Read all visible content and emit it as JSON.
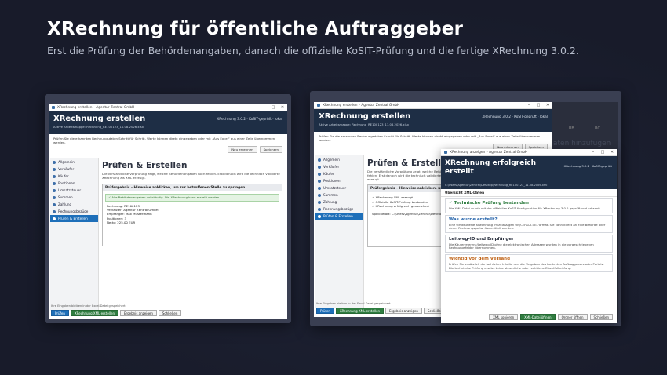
{
  "page": {
    "title": "XRechnung für öffentliche Auftraggeber",
    "subtitle": "Erst die Prüfung der Behördenangaben, danach die offizielle KoSIT-Prüfung und die fertige XRechnung 3.0.2."
  },
  "left": {
    "titlebar": "XRechnung erstellen – Agentur Zentral GmbH",
    "header_title": "XRechnung erstellen",
    "header_version": "XRechnung 3.0.2 · KoSIT-geprüft · lokal",
    "header_sub": "Aktive Arbeitsmappe: Rechnung_RE100123_11.08.2026.xlsx",
    "intro": "Prüfen Sie die erkannten Rechnungsdaten Schritt für Schritt. Werte können direkt eingegeben oder mit „Aus Excel“ aus einer Zeile übernommen werden.",
    "btn_new": "Neu erkennen",
    "btn_save": "Speichern",
    "nav": [
      "Allgemein",
      "Verkäufer",
      "Käufer",
      "Positionen",
      "Umsatzsteuer",
      "Summen",
      "Zahlung",
      "Rechnungsbezüge",
      "Prüfen & Erstellen"
    ],
    "main_title": "Prüfen & Erstellen",
    "main_desc": "Die verständliche Vorprüfung zeigt, welche Behördenangaben noch fehlen. Erst danach wird die technisch validierte XRechnung als XML erzeugt.",
    "box_header": "Prüfergebnis – Hinweise anklicken, um zur betroffenen Stelle zu springen",
    "ok_text": "✓ Alle Behördenangaben vollständig. Die XRechnung kann erstellt werden.",
    "lines": [
      "Rechnung: RE100123",
      "Verkäufer: Agentur Zentral GmbH",
      "Empfänger: Max Mustermann",
      "Positionen: 3",
      "Netto: 225,00 EUR"
    ],
    "status": "Ihre Eingaben bleiben in der Excel-Datei gespeichert.",
    "actions": [
      "Prüfen",
      "XRechnung XML erstellen",
      "Ergebnis anzeigen",
      "Schließen"
    ]
  },
  "right": {
    "titlebar": "XRechnung erstellen – Agentur Zentral GmbH",
    "header_title": "XRechnung erstellen",
    "header_version": "XRechnung 3.0.2 · KoSIT-geprüft · lokal",
    "header_sub": "Aktive Arbeitsmappe: Rechnung_RE100123_11.08.2026.xlsx",
    "intro": "Prüfen Sie die erkannten Rechnungsdaten Schritt für Schritt. Werte können direkt eingegeben oder mit „Aus Excel“ aus einer Zeile übernommen werden.",
    "btn_new": "Neu erkennen",
    "btn_save": "Speichern",
    "nav": [
      "Allgemein",
      "Verkäufer",
      "Käufer",
      "Positionen",
      "Umsatzsteuer",
      "Summen",
      "Zahlung",
      "Rechnungsbezüge",
      "Prüfen & Erstellen"
    ],
    "main_title": "Prüfen & Erstellen",
    "main_desc": "Die verständliche Vorprüfung zeigt, welche Behördenangaben noch fehlen. Erst danach wird die technisch validierte XRechnung als XML erzeugt.",
    "box_header": "Prüfergebnis – Hinweise anklicken, um zur betroffenen Stelle zu springen",
    "lines": [
      "✓ XRechnung-XML erzeugt",
      "✓ Offizielle KoSIT-Prüfung bestanden",
      "✓ XRechnung erfolgreich gespeichert"
    ],
    "saved": "Speicherort: C:\\Users\\Agentur\\Zentral\\Desktop\\",
    "status": "Ihre Eingaben bleiben in der Excel-Datei gespeichert.",
    "actions": [
      "Prüfen",
      "XRechnung XML erstellen",
      "Ergebnis anzeigen",
      "Schließen"
    ],
    "bg_text": "aten hinzufügen",
    "bg_cols": [
      "BB",
      "BC"
    ]
  },
  "dialog": {
    "titlebar": "XRechnung anzeigen – Agentur Zentral GmbH",
    "title": "XRechnung erfolgreich erstellt",
    "version": "XRechnung 3.0.2 · KoSIT-geprüft",
    "path": "C:\\Users\\Agentur\\Zentral\\Desktop\\Rechnung_RE100123_11.08.2026.xml",
    "tabs": "Übersicht  XML-Daten",
    "sections": [
      {
        "title": "✓ Technische Prüfung bestanden",
        "color": "#2f7d40",
        "text": "Die XML-Datei wurde mit der offiziellen KoSIT-Konfiguration für XRechnung 3.0.2 geprüft und erkannt."
      },
      {
        "title": "Was wurde erstellt?",
        "color": "#1e5fa8",
        "text": "Eine strukturierte XRechnung im zulässigen UN/CEFACT-CII-Format. Sie kann direkt an eine Behörde oder deren Rechnungsportal übermittelt werden."
      },
      {
        "title": "Leitweg-ID und Empfänger",
        "color": "#2c3240",
        "text": "Die Käuferreferenz/Leitweg-ID ohne die elektronischen Adressen wurden in die vorgeschriebenen Rechnungsfelder übernommen."
      },
      {
        "title": "Wichtig vor dem Versand",
        "color": "#c0651a",
        "text": "Prüfen Sie zusätzlich die fachlichen Inhalte und die Vorgaben des konkreten Auftraggebers oder Portals. Die technische Prüfung ersetzt keine steuerliche oder rechtliche Einzelfallprüfung."
      }
    ],
    "buttons": [
      "XML kopieren",
      "XML-Datei öffnen",
      "Ordner öffnen",
      "Schließen"
    ]
  }
}
